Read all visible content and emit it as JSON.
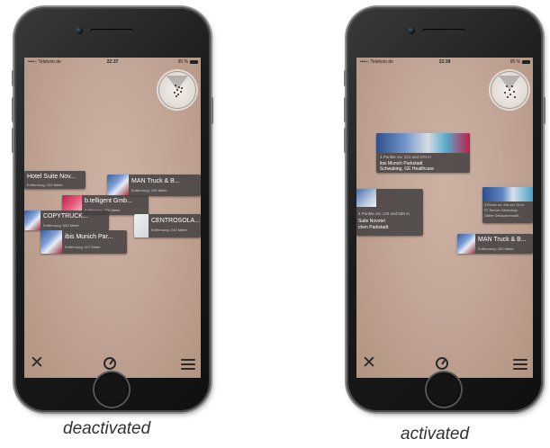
{
  "left_phone": {
    "status": {
      "carrier": "••••○ Telekom.de",
      "time": "22:37",
      "battery": "95 %"
    },
    "pois": [
      {
        "title": "Hotel Suite Nov...",
        "subtitle": "Entfernung: 129 Meter"
      },
      {
        "title": "MAN Truck & B...",
        "subtitle": "Entfernung: 196 Meter"
      },
      {
        "title": "b.telligent Gmb...",
        "subtitle": "Entfernung: 208 Meter"
      },
      {
        "title": "COPYTRUCK...",
        "subtitle": "Entfernung: 632 Meter"
      },
      {
        "title": "CENTROSOLA...",
        "subtitle": "Entfernung: 240 Meter"
      },
      {
        "title": "ibis Munich Par...",
        "subtitle": "Entfernung: 117 Meter"
      }
    ],
    "caption": "deactivated"
  },
  "right_phone": {
    "status": {
      "carrier": "••••○ Telekom.de",
      "time": "22:39",
      "battery": "95 %"
    },
    "pois": [
      {
        "title": "4 Punkte zw. 121 und 270 m",
        "line1": "ibis Munich Parkstadt",
        "line2": "Schwabing, GE Healthcare"
      },
      {
        "title": "4 Punkte zw. 133 und 606 m",
        "line1": "Suite Novotel",
        "line2": "chen Parkstadt"
      },
      {
        "title": "3 Punkte zw. 408 und 740 m",
        "line1": "PC Service Gebäudege...",
        "line2": "Oldner Gebäudeverwaltl..."
      },
      {
        "title": "MAN Truck & B...",
        "subtitle": "Entfernung: 200 Meter"
      }
    ],
    "caption": "activated"
  },
  "toolbar": {
    "close_icon": "close-icon",
    "radar_icon": "radar-icon",
    "menu_icon": "menu-icon"
  }
}
